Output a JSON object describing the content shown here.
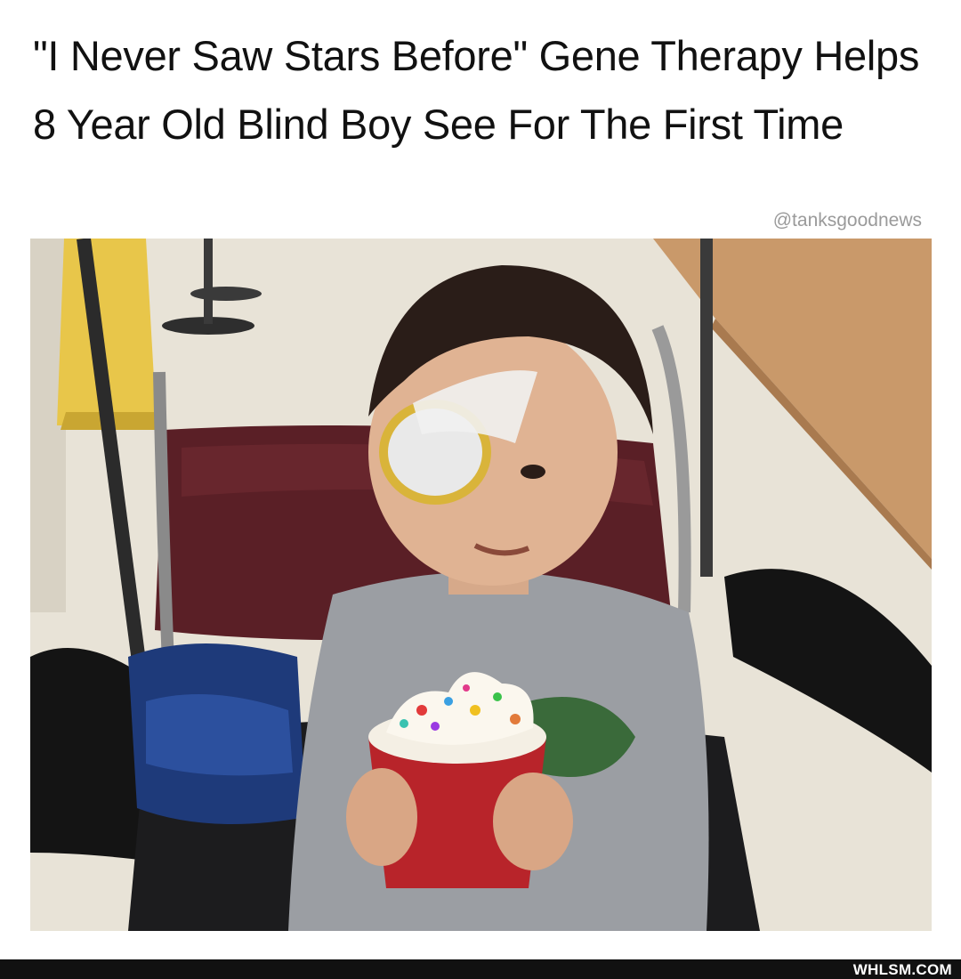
{
  "post": {
    "headline": "\"I Never Saw Stars Before\" Gene Therapy Helps 8 Year Old Blind Boy See For The First Time",
    "handle": "@tanksgoodnews"
  },
  "footer": {
    "brand": "WHLSM.COM"
  },
  "colors": {
    "background": "#ffffff",
    "headline_text": "#111111",
    "handle_text": "#9a9a9a",
    "footer_bar": "#111111",
    "footer_text": "#ffffff"
  }
}
